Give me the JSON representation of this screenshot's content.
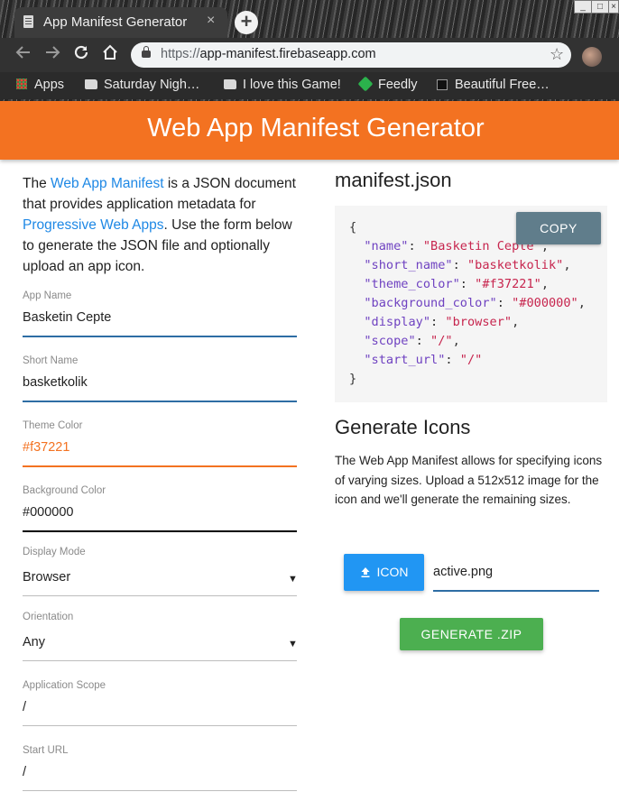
{
  "browser": {
    "tab_title": "App Manifest Generator",
    "tab_close": "×",
    "new_tab": "+",
    "window_controls": [
      "_",
      "□",
      "×"
    ],
    "nav_icons": [
      "arrow-left",
      "arrow-right",
      "reload",
      "home"
    ],
    "url_scheme": "https://",
    "url_host": "app-manifest.firebaseapp.com",
    "bookmarks": [
      {
        "label": "Apps",
        "icon": "apps-grid"
      },
      {
        "label": "Saturday Nigh…",
        "icon": "folder"
      },
      {
        "label": "I love this Game!",
        "icon": "folder"
      },
      {
        "label": "Feedly",
        "icon": "feedly"
      },
      {
        "label": "Beautiful Free…",
        "icon": "page"
      }
    ]
  },
  "header": {
    "title": "Web App Manifest Generator",
    "bg_color": "#f37221"
  },
  "intro": {
    "t1": "The ",
    "link1": "Web App Manifest",
    "t2": " is a JSON document that provides application metadata for ",
    "link2": "Progressive Web Apps",
    "t3": ". Use the form below to generate the JSON file and optionally upload an app icon."
  },
  "form": {
    "app_name": {
      "label": "App Name",
      "value": "Basketin Cepte"
    },
    "short_name": {
      "label": "Short Name",
      "value": "basketkolik"
    },
    "theme_color": {
      "label": "Theme Color",
      "value": "#f37221"
    },
    "background_color": {
      "label": "Background Color",
      "value": "#000000"
    },
    "display_mode": {
      "label": "Display Mode",
      "value": "Browser"
    },
    "orientation": {
      "label": "Orientation",
      "value": "Any"
    },
    "scope": {
      "label": "Application Scope",
      "value": "/"
    },
    "start_url": {
      "label": "Start URL",
      "value": "/"
    }
  },
  "manifest": {
    "title": "manifest.json",
    "copy_label": "COPY",
    "open_brace": "{",
    "close_brace": "}",
    "lines": [
      {
        "key": "\"name\"",
        "value": "\"Basketin Cepte\""
      },
      {
        "key": "\"short_name\"",
        "value": "\"basketkolik\""
      },
      {
        "key": "\"theme_color\"",
        "value": "\"#f37221\""
      },
      {
        "key": "\"background_color\"",
        "value": "\"#000000\""
      },
      {
        "key": "\"display\"",
        "value": "\"browser\""
      },
      {
        "key": "\"scope\"",
        "value": "\"/\""
      },
      {
        "key": "\"start_url\"",
        "value": "\"/\""
      }
    ]
  },
  "icons": {
    "title": "Generate Icons",
    "description": "The Web App Manifest allows for specifying icons of varying sizes. Upload a 512x512 image for the icon and we'll generate the remaining sizes.",
    "icon_button": "ICON",
    "file_name": "active.png",
    "generate_button": "GENERATE .ZIP"
  }
}
